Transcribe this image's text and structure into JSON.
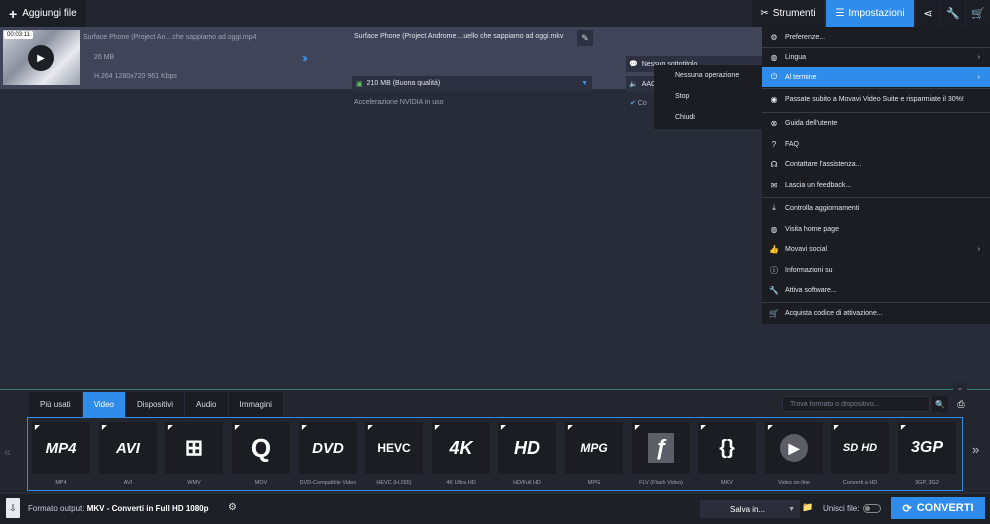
{
  "topbar": {
    "add_files": "Aggiungi file",
    "tools": "Strumenti",
    "settings": "Impostazioni"
  },
  "file": {
    "time": "00:03:11",
    "source_name": "Surface Phone (Project An…che sappiamo ad oggi.mp4",
    "source_size": "26 MB",
    "source_info": "H.264 1280x720 961 Kbps",
    "output_name": "Surface Phone (Project Androme…uello che sappiamo ad oggi.mkv",
    "quality": "210 MB (Buona qualità)",
    "acceleration": "Accelerazione NVIDIA in uso",
    "subtitles": "Nessun sottotitolo",
    "audio": "AAC 191 Kbps Stereo",
    "compress_partial": "Co"
  },
  "submenu": {
    "items": [
      "Nessuna operazione",
      "Stop",
      "Chiudi"
    ]
  },
  "menu": {
    "items": [
      {
        "label": "Preferenze...",
        "icon": "gear-icon"
      },
      {
        "label": "Lingua",
        "icon": "globe-icon",
        "sub": "›"
      },
      {
        "label": "Al termine",
        "icon": "power-icon",
        "sub": "›"
      },
      {
        "label": "Passate subito a Movavi Video Suite e risparmiate il 30%!",
        "icon": "suite-icon"
      },
      {
        "label": "Guida dell'utente",
        "icon": "lifebuoy-icon"
      },
      {
        "label": "FAQ",
        "icon": "question-icon"
      },
      {
        "label": "Contattare l'assistenza...",
        "icon": "headset-icon"
      },
      {
        "label": "Lascia un feedback...",
        "icon": "mail-icon"
      },
      {
        "label": "Controlla aggiornamenti",
        "icon": "download-icon"
      },
      {
        "label": "Visita home page",
        "icon": "home-globe-icon"
      },
      {
        "label": "Movavi social",
        "icon": "thumbs-up-icon",
        "sub": "›"
      },
      {
        "label": "Informazioni su",
        "icon": "info-icon"
      },
      {
        "label": "Attiva software...",
        "icon": "wrench-icon"
      },
      {
        "label": "Acquista codice di attivazione...",
        "icon": "cart-icon"
      }
    ]
  },
  "tabs": [
    "Più usati",
    "Video",
    "Dispositivi",
    "Audio",
    "Immagini"
  ],
  "search": {
    "placeholder": "Trova formato o dispositivo..."
  },
  "formats": [
    {
      "tile": "MP4",
      "label": "MP4"
    },
    {
      "tile": "AVI",
      "label": "AVI"
    },
    {
      "tile": "⊞",
      "label": "WMV"
    },
    {
      "tile": "Q",
      "label": "MOV"
    },
    {
      "tile": "DVD",
      "label": "DVD-Compatible Video"
    },
    {
      "tile": "HEVC",
      "label": "HEVC (H.265)"
    },
    {
      "tile": "4K",
      "label": "4K Ultra HD"
    },
    {
      "tile": "HD",
      "label": "HD/Full HD"
    },
    {
      "tile": "MPG",
      "label": "MPG"
    },
    {
      "tile": "ƒ",
      "label": "FLV (Flash Video)"
    },
    {
      "tile": "{}",
      "label": "MKV"
    },
    {
      "tile": "▶",
      "label": "Video on-line"
    },
    {
      "tile": "SD HD",
      "label": "Converti a HD"
    },
    {
      "tile": "3GP",
      "label": "3GP, 3G2"
    }
  ],
  "status": {
    "output_label": "Formato output:",
    "output_value": "MKV - Converti in Full HD 1080p",
    "save_to": "Salva in...",
    "merge": "Unisci file:",
    "convert": "CONVERTI"
  }
}
